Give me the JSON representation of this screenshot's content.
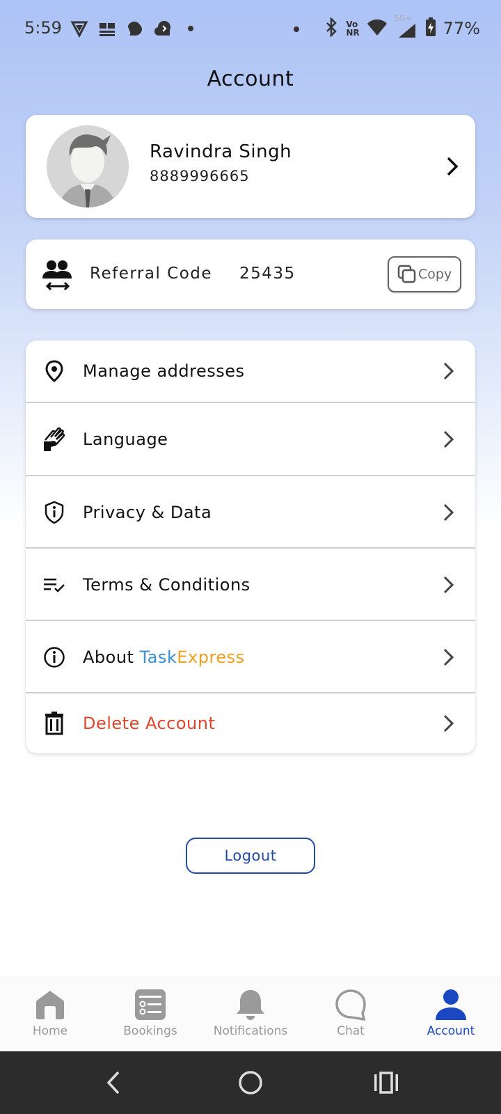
{
  "status_bar": {
    "time": "5:59",
    "battery": "77%",
    "left_icons": [
      "vpn-shield-icon",
      "news-app-icon",
      "bird-icon",
      "cloud-icon",
      "dot-icon"
    ],
    "right_icons": [
      "dot-icon",
      "bluetooth-icon",
      "vonr-icon",
      "wifi-icon",
      "signal-5g-icon",
      "battery-charging-icon"
    ],
    "network_vonr_top": "Vo",
    "network_vonr_bottom": "NR",
    "network_5g": "5G+"
  },
  "header": {
    "title": "Account"
  },
  "profile": {
    "name": "Ravindra Singh",
    "phone": "8889996665"
  },
  "referral": {
    "label": "Referral Code",
    "code": "25435",
    "copy_label": "Copy"
  },
  "menu": {
    "manage_addresses": "Manage addresses",
    "language": "Language",
    "privacy": "Privacy & Data",
    "terms": "Terms & Conditions",
    "about_prefix": "About ",
    "about_brand_part1": "Task",
    "about_brand_part2": "Express",
    "delete_account": "Delete Account"
  },
  "logout_label": "Logout",
  "bottom_nav": {
    "home": "Home",
    "bookings": "Bookings",
    "notifications": "Notifications",
    "chat": "Chat",
    "account": "Account",
    "active": "Account"
  },
  "colors": {
    "accent_blue": "#1a47c2",
    "brand_task": "#3a8fd6",
    "brand_express": "#f0a020",
    "danger": "#e0442a"
  }
}
